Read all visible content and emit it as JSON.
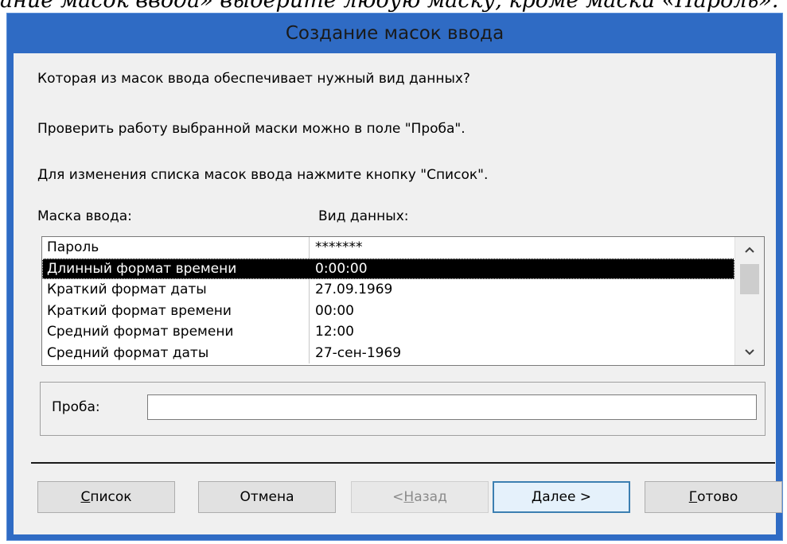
{
  "document_caption": "ание масок ввода» выберите любую маску, кроме маски «Пароль».",
  "window": {
    "title": "Создание масок ввода"
  },
  "prompts": [
    "Которая из масок ввода обеспечивает нужный вид данных?",
    "Проверить работу выбранной маски можно в поле \"Проба\".",
    "Для изменения списка масок ввода нажмите кнопку \"Список\"."
  ],
  "list": {
    "columns": {
      "mask": "Маска ввода:",
      "view": "Вид данных:"
    },
    "rows": [
      {
        "mask": "Пароль",
        "view": "*******"
      },
      {
        "mask": "Длинный формат времени",
        "view": "0:00:00"
      },
      {
        "mask": "Краткий формат даты",
        "view": "27.09.1969"
      },
      {
        "mask": "Краткий формат времени",
        "view": "00:00"
      },
      {
        "mask": "Средний формат времени",
        "view": "12:00"
      },
      {
        "mask": "Средний формат даты",
        "view": "27-сен-1969"
      }
    ],
    "selected_index": 1
  },
  "probe": {
    "label": "Проба:",
    "value": ""
  },
  "buttons": {
    "list": {
      "mnemonic": "С",
      "rest": "писок"
    },
    "cancel": "Отмена",
    "back": {
      "prefix": "< ",
      "mnemonic": "Н",
      "rest": "азад"
    },
    "next": {
      "mnemonic": "Д",
      "rest": "алее >"
    },
    "finish": {
      "mnemonic": "Г",
      "rest": "отово"
    }
  },
  "colors": {
    "title_bar": "#2f6bc4",
    "client_bg": "#f0f0f0",
    "selection": "#000000",
    "default_button_border": "#3c7fb1"
  },
  "icons": {
    "scroll_up": "chevron-up-icon",
    "scroll_down": "chevron-down-icon"
  }
}
